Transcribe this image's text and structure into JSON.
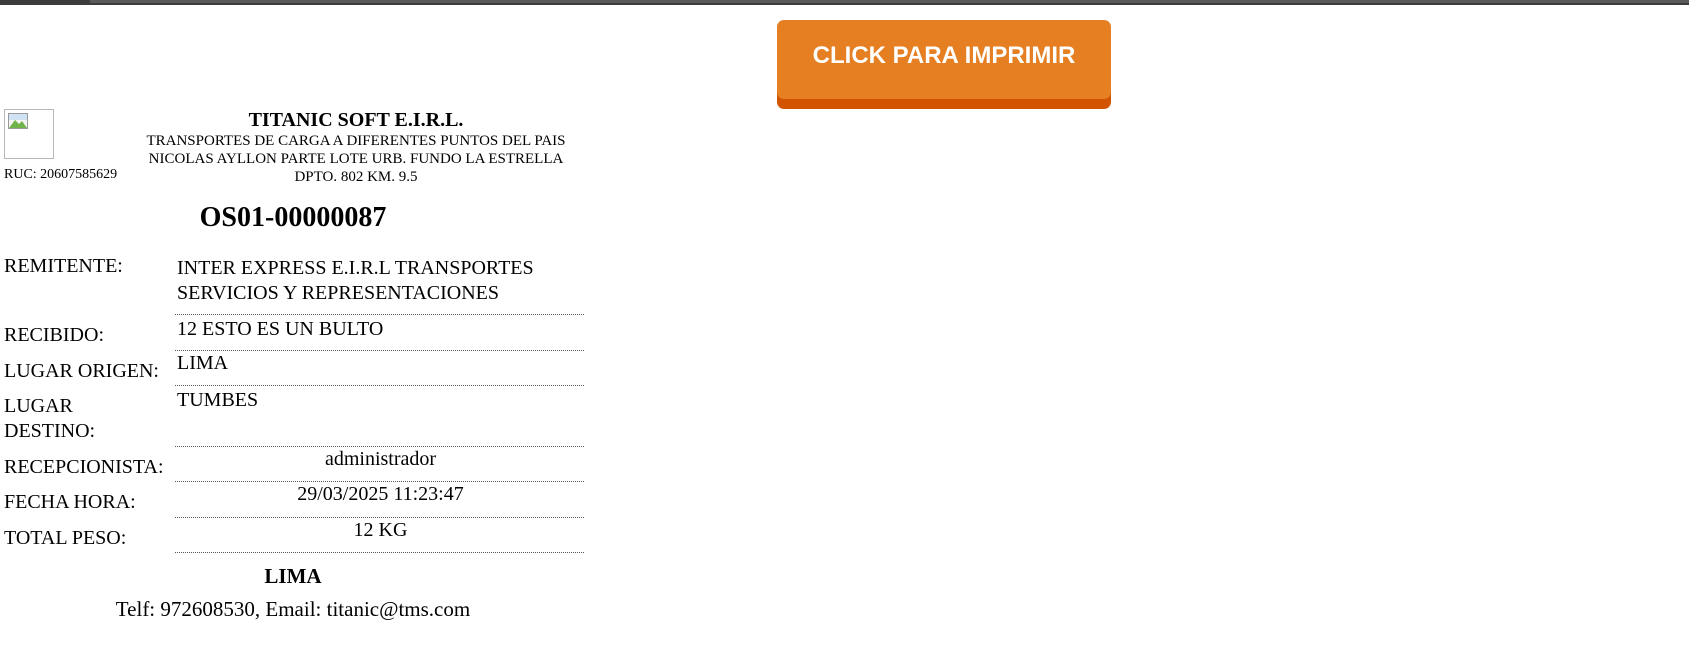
{
  "print_button": {
    "label": "CLICK PARA IMPRIMIR"
  },
  "company": {
    "name": "TITANIC SOFT E.I.R.L.",
    "lines": [
      "TRANSPORTES DE CARGA A DIFERENTES PUNTOS DEL PAIS",
      "NICOLAS AYLLON PARTE LOTE URB. FUNDO LA ESTRELLA",
      "DPTO. 802 KM. 9.5"
    ],
    "ruc": "RUC: 20607585629"
  },
  "order": {
    "number": "OS01-00000087"
  },
  "fields": [
    {
      "label": "REMITENTE:",
      "value": "INTER EXPRESS E.I.R.L TRANSPORTES SERVICIOS Y REPRESENTACIONES"
    },
    {
      "label": "RECIBIDO:",
      "value": "12 ESTO ES UN BULTO"
    },
    {
      "label": "LUGAR ORIGEN:",
      "value": "LIMA"
    },
    {
      "label": "LUGAR DESTINO:",
      "value": "TUMBES"
    },
    {
      "label": "RECEPCIONISTA:",
      "value": "administrador"
    },
    {
      "label": "FECHA HORA:",
      "value": "29/03/2025 11:23:47"
    },
    {
      "label": "TOTAL PESO:",
      "value": "12 KG"
    }
  ],
  "footer": {
    "city": "LIMA",
    "contact": "Telf: 972608530, Email: titanic@tms.com"
  },
  "colors": {
    "button": "#e67e22",
    "button_shadow": "#d35400"
  }
}
